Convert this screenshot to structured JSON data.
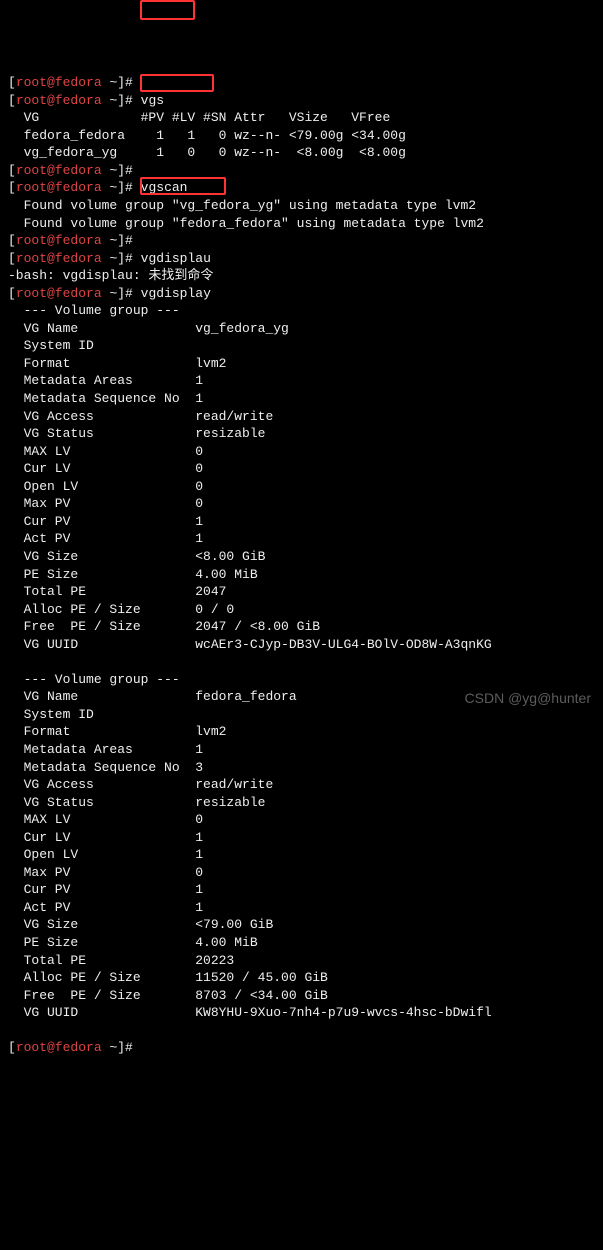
{
  "prompt": {
    "user": "root",
    "host": "fedora",
    "dir": "~",
    "symbol": "#"
  },
  "cmd1": "vgs",
  "vgs_header": "  VG             #PV #LV #SN Attr   VSize   VFree",
  "vgs_row1": "  fedora_fedora    1   1   0 wz--n- <79.00g <34.00g",
  "vgs_row2": "  vg_fedora_yg     1   0   0 wz--n-  <8.00g  <8.00g",
  "cmd2": "vgscan",
  "vgscan_line1": "  Found volume group \"vg_fedora_yg\" using metadata type lvm2",
  "vgscan_line2": "  Found volume group \"fedora_fedora\" using metadata type lvm2",
  "cmd3_bad": "vgdisplau",
  "bash_err": "-bash: vgdisplau: 未找到命令",
  "cmd3": "vgdisplay",
  "vg1": {
    "header": "  --- Volume group ---",
    "rows": [
      [
        "  VG Name",
        "vg_fedora_yg"
      ],
      [
        "  System ID",
        ""
      ],
      [
        "  Format",
        "lvm2"
      ],
      [
        "  Metadata Areas",
        "1"
      ],
      [
        "  Metadata Sequence No",
        "1"
      ],
      [
        "  VG Access",
        "read/write"
      ],
      [
        "  VG Status",
        "resizable"
      ],
      [
        "  MAX LV",
        "0"
      ],
      [
        "  Cur LV",
        "0"
      ],
      [
        "  Open LV",
        "0"
      ],
      [
        "  Max PV",
        "0"
      ],
      [
        "  Cur PV",
        "1"
      ],
      [
        "  Act PV",
        "1"
      ],
      [
        "  VG Size",
        "<8.00 GiB"
      ],
      [
        "  PE Size",
        "4.00 MiB"
      ],
      [
        "  Total PE",
        "2047"
      ],
      [
        "  Alloc PE / Size",
        "0 / 0"
      ],
      [
        "  Free  PE / Size",
        "2047 / <8.00 GiB"
      ],
      [
        "  VG UUID",
        "wcAEr3-CJyp-DB3V-ULG4-BOlV-OD8W-A3qnKG"
      ]
    ]
  },
  "vg2": {
    "header": "  --- Volume group ---",
    "rows": [
      [
        "  VG Name",
        "fedora_fedora"
      ],
      [
        "  System ID",
        ""
      ],
      [
        "  Format",
        "lvm2"
      ],
      [
        "  Metadata Areas",
        "1"
      ],
      [
        "  Metadata Sequence No",
        "3"
      ],
      [
        "  VG Access",
        "read/write"
      ],
      [
        "  VG Status",
        "resizable"
      ],
      [
        "  MAX LV",
        "0"
      ],
      [
        "  Cur LV",
        "1"
      ],
      [
        "  Open LV",
        "1"
      ],
      [
        "  Max PV",
        "0"
      ],
      [
        "  Cur PV",
        "1"
      ],
      [
        "  Act PV",
        "1"
      ],
      [
        "  VG Size",
        "<79.00 GiB"
      ],
      [
        "  PE Size",
        "4.00 MiB"
      ],
      [
        "  Total PE",
        "20223"
      ],
      [
        "  Alloc PE / Size",
        "11520 / 45.00 GiB"
      ],
      [
        "  Free  PE / Size",
        "8703 / <34.00 GiB"
      ],
      [
        "  VG UUID",
        "KW8YHU-9Xuo-7nh4-p7u9-wvcs-4hsc-bDwifl"
      ]
    ]
  },
  "watermark": "CSDN @yg@hunter"
}
